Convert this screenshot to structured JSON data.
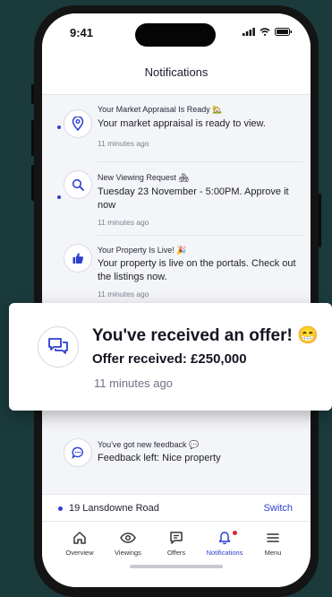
{
  "status_bar": {
    "time": "9:41"
  },
  "header": {
    "title": "Notifications"
  },
  "notifications": [
    {
      "title": "Your Market Appraisal Is Ready 🏡",
      "body": "Your market appraisal is ready to view.",
      "time": "11 minutes ago",
      "icon": "location-pin-icon",
      "unread": true
    },
    {
      "title": "New Viewing Request 🏘",
      "body": "Tuesday 23 November - 5:00PM. Approve it now",
      "time": "11 minutes ago",
      "icon": "search-icon",
      "unread": true
    },
    {
      "title": "Your Property Is Live! 🎉",
      "body": "Your property is live on the portals. Check out the listings now.",
      "time": "11 minutes ago",
      "icon": "thumbs-up-icon",
      "unread": false
    },
    {
      "title": "You've got new feedback 💬",
      "body": "Feedback left: Nice property",
      "time": "",
      "icon": "chat-bubble-icon",
      "unread": false
    }
  ],
  "offer_card": {
    "title": "You've received an offer! 😁",
    "subtitle": "Offer received: £250,000",
    "time": "11 minutes ago",
    "icon": "chat-bubbles-icon"
  },
  "property_bar": {
    "address": "19 Lansdowne Road",
    "switch_label": "Switch"
  },
  "tabbar": {
    "items": [
      {
        "label": "Overview",
        "icon": "home-icon"
      },
      {
        "label": "Viewings",
        "icon": "eye-icon"
      },
      {
        "label": "Offers",
        "icon": "offer-chat-icon"
      },
      {
        "label": "Notifications",
        "icon": "bell-icon",
        "active": true,
        "has_badge": true
      },
      {
        "label": "Menu",
        "icon": "menu-icon"
      }
    ]
  },
  "colors": {
    "accent": "#2d3fd0",
    "badge": "#e0243a",
    "background": "#1a3a3c"
  }
}
